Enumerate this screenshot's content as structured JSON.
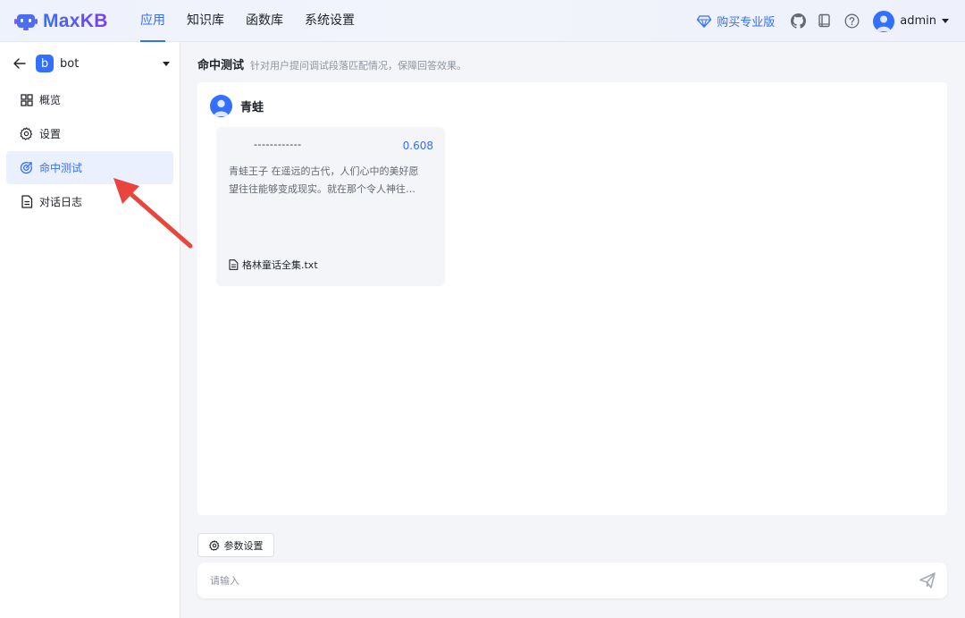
{
  "brand": {
    "name": "MaxKB",
    "accent": "#3370ff"
  },
  "nav": {
    "items": [
      "应用",
      "知识库",
      "函数库",
      "系统设置"
    ],
    "active": 0
  },
  "header": {
    "upgrade_label": "购买专业版",
    "icons": [
      "github-icon",
      "book-icon",
      "help-icon"
    ],
    "user_name": "admin"
  },
  "sidebar": {
    "app_badge": "b",
    "app_name": "bot",
    "items": [
      {
        "label": "概览",
        "icon": "grid-icon"
      },
      {
        "label": "设置",
        "icon": "gear-icon"
      },
      {
        "label": "命中测试",
        "icon": "target-icon",
        "active": true
      },
      {
        "label": "对话日志",
        "icon": "document-icon"
      }
    ]
  },
  "main": {
    "title": "命中测试",
    "description": "针对用户提问调试段落匹配情况，保障回答效果。",
    "query": "青蛙",
    "results": [
      {
        "title": "------------",
        "score": "0.608",
        "content_line1": "青蛙王子 在遥远的古代，人们心中的美好愿",
        "content_line2": "望往往能够变成现实。就在那个令人神往…",
        "file": "格林童话全集.txt"
      }
    ],
    "param_button": "参数设置",
    "input_placeholder": "请输入"
  }
}
